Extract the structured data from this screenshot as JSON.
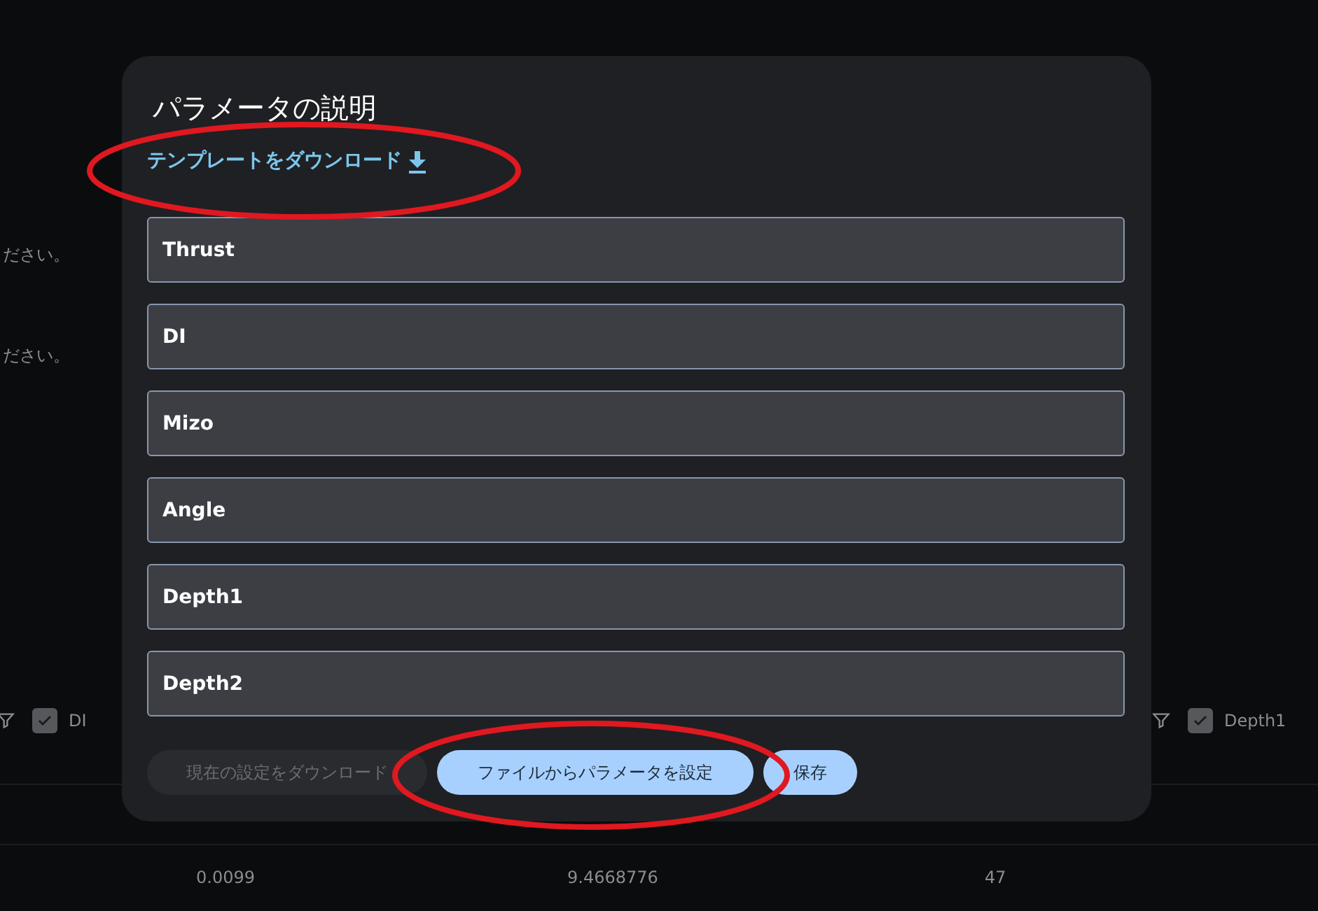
{
  "background": {
    "hints": [
      "ださい。",
      "ださい。"
    ],
    "filters": [
      {
        "label": "DI",
        "checked": true
      },
      {
        "label": "Depth1",
        "checked": true
      }
    ],
    "values": [
      "0.0099",
      "9.4668776",
      "47"
    ]
  },
  "dialog": {
    "title": "パラメータの説明",
    "template_link": "テンプレートをダウンロード",
    "fields": [
      {
        "value": "Thrust"
      },
      {
        "value": "DI"
      },
      {
        "value": "Mizo"
      },
      {
        "value": "Angle"
      },
      {
        "value": "Depth1"
      },
      {
        "value": "Depth2"
      }
    ],
    "buttons": [
      {
        "label": "現在の設定をダウンロード",
        "disabled": true
      },
      {
        "label": "ファイルからパラメータを設定",
        "disabled": false
      },
      {
        "label": "保存",
        "disabled": false
      }
    ]
  }
}
